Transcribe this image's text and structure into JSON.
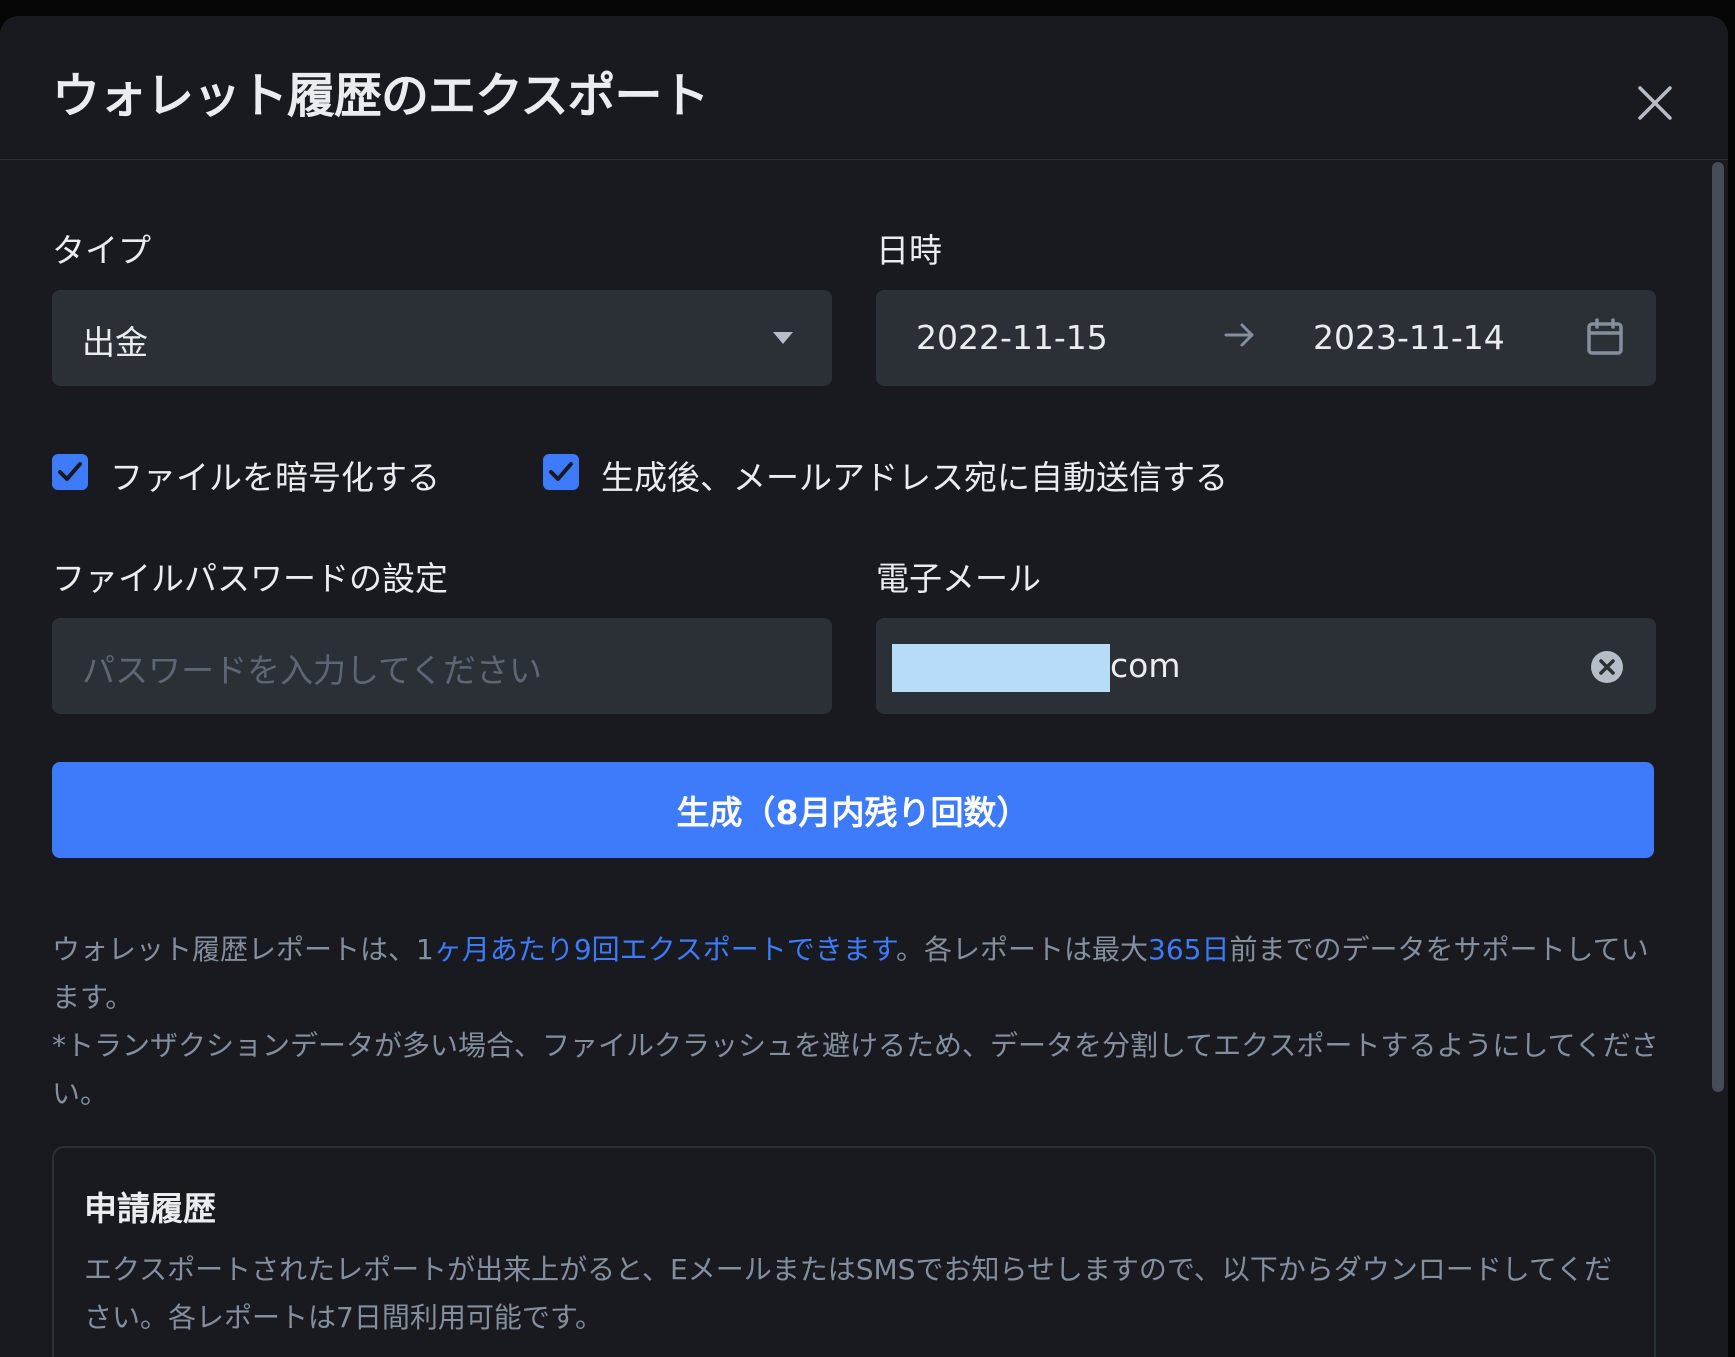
{
  "title": "ウォレット履歴のエクスポート",
  "type_field": {
    "label": "タイプ",
    "value": "出金"
  },
  "date_field": {
    "label": "日時",
    "start": "2022-11-15",
    "arrow": "→",
    "end": "2023-11-14"
  },
  "options": {
    "encrypt_label": "ファイルを暗号化する",
    "encrypt_checked": true,
    "auto_send_label": "生成後、メールアドレス宛に自動送信する",
    "auto_send_checked": true
  },
  "password_field": {
    "label": "ファイルパスワードの設定",
    "placeholder": "パスワードを入力してください"
  },
  "email_field": {
    "label": "電子メール",
    "value_suffix": "com"
  },
  "generate_button": {
    "label": "生成（8月内残り回数）"
  },
  "notes": {
    "p1_a": "ウォレット履歴レポートは、1",
    "p1_hl1": "ヶ月あたり9回エクスポートできます",
    "p1_b": "。各レポートは最大",
    "p1_hl2": "365日",
    "p1_c": "前までのデータをサポートしています。",
    "p2": "*トランザクションデータが多い場合、ファイルクラッシュを避けるため、データを分割してエクスポートするようにしてください。"
  },
  "history": {
    "title": "申請履歴",
    "description": "エクスポートされたレポートが出来上がると、EメールまたはSMSでお知らせしますので、以下からダウンロードしてください。各レポートは7日間利用可能です。"
  },
  "colors": {
    "accent": "#3d7bfa",
    "background": "#181a20",
    "field": "#2b2f36",
    "text": "#eaecef",
    "muted": "#848e9c"
  }
}
